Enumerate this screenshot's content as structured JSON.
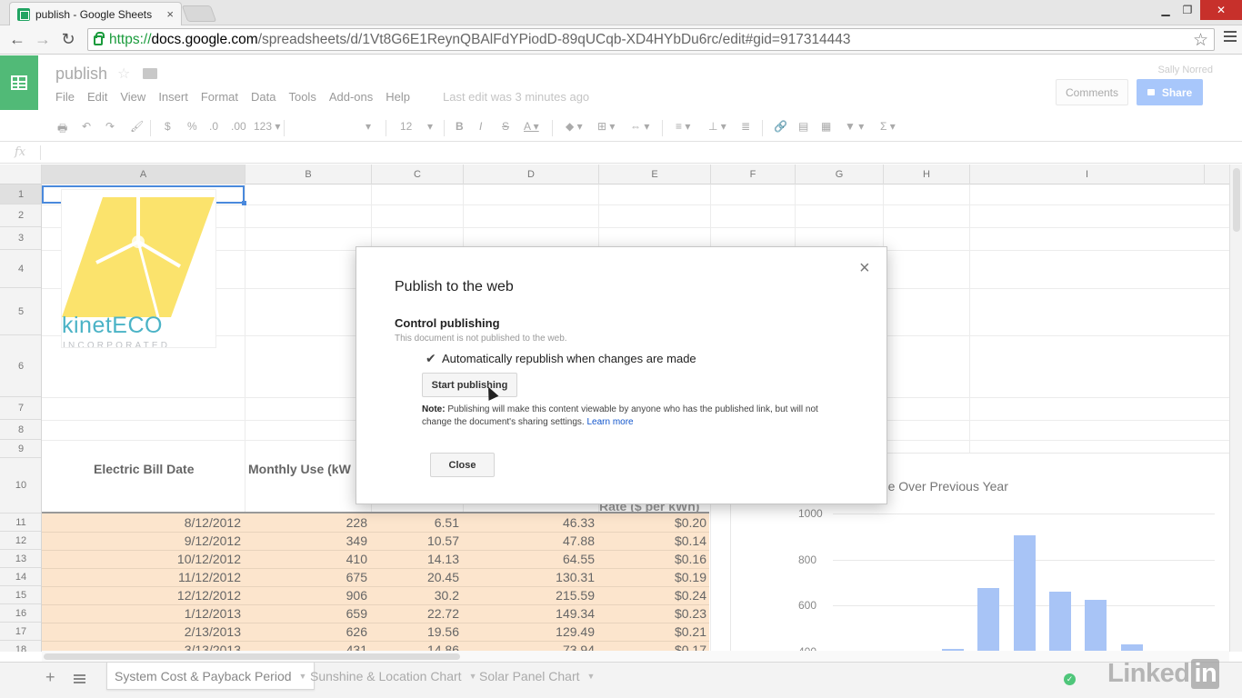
{
  "browser": {
    "tab_title": "publish - Google Sheets",
    "tab_close": "×",
    "url_scheme": "https://",
    "url_host": "docs.google.com",
    "url_path": "/spreadsheets/d/1Vt8G6E1ReynQBAlFdYPiodD-89qUCqb-XD4HYbDu6rc/edit#gid=917314443"
  },
  "app": {
    "doc_title": "publish",
    "menus": [
      "File",
      "Edit",
      "View",
      "Insert",
      "Format",
      "Data",
      "Tools",
      "Add-ons",
      "Help"
    ],
    "last_edit": "Last edit was 3 minutes ago",
    "user": "Sally Norred",
    "comments_label": "Comments",
    "share_label": "Share",
    "font_size": "12",
    "fx": "fx"
  },
  "columns": [
    "A",
    "B",
    "C",
    "D",
    "E",
    "F",
    "G",
    "H",
    "I"
  ],
  "rows": [
    "1",
    "2",
    "3",
    "4",
    "5",
    "6",
    "7",
    "8",
    "9",
    "10",
    "11",
    "12",
    "13",
    "14",
    "15",
    "16",
    "17",
    "18"
  ],
  "logo": {
    "name": "kinetECO",
    "sub": "INCORPORATED"
  },
  "table": {
    "head_date": "Electric Bill Date",
    "head_use": "Monthly Use (kW",
    "head_rate": "Rate ($ per kWh)",
    "data": [
      [
        "8/12/2012",
        "228",
        "6.51",
        "46.33",
        "$0.20"
      ],
      [
        "9/12/2012",
        "349",
        "10.57",
        "47.88",
        "$0.14"
      ],
      [
        "10/12/2012",
        "410",
        "14.13",
        "64.55",
        "$0.16"
      ],
      [
        "11/12/2012",
        "675",
        "20.45",
        "130.31",
        "$0.19"
      ],
      [
        "12/12/2012",
        "906",
        "30.2",
        "215.59",
        "$0.24"
      ],
      [
        "1/12/2013",
        "659",
        "22.72",
        "149.34",
        "$0.23"
      ],
      [
        "2/13/2013",
        "626",
        "19.56",
        "129.49",
        "$0.21"
      ],
      [
        "3/13/2013",
        "431",
        "14.86",
        "73.94",
        "$0.17"
      ]
    ]
  },
  "chart_data": {
    "type": "bar",
    "title": "sage Over Previous Year",
    "y_ticks": [
      "1000",
      "800",
      "600",
      "400"
    ],
    "values": [
      410,
      675,
      906,
      659,
      626,
      431
    ],
    "ylim": [
      400,
      1000
    ]
  },
  "dialog": {
    "title": "Publish to the web",
    "section": "Control publishing",
    "status": "This document is not published to the web.",
    "checkbox_label": "Automatically republish when changes are made",
    "start_label": "Start publishing",
    "note_bold": "Note:",
    "note_text": " Publishing will make this content viewable by anyone who has the published link, but will not change the document's sharing settings. ",
    "learn_more": "Learn more",
    "close_label": "Close",
    "close_x": "×"
  },
  "sheets": [
    {
      "label": "System Cost & Payback Period",
      "active": true
    },
    {
      "label": "Sunshine & Location Chart",
      "active": false
    },
    {
      "label": "Solar Panel Chart",
      "active": false
    }
  ],
  "watermark": {
    "text": "Linked",
    "badge": "in"
  },
  "colors": {
    "accent": "#4a89dc",
    "band": "#fce5cd",
    "sheets_green": "#51ba77"
  }
}
